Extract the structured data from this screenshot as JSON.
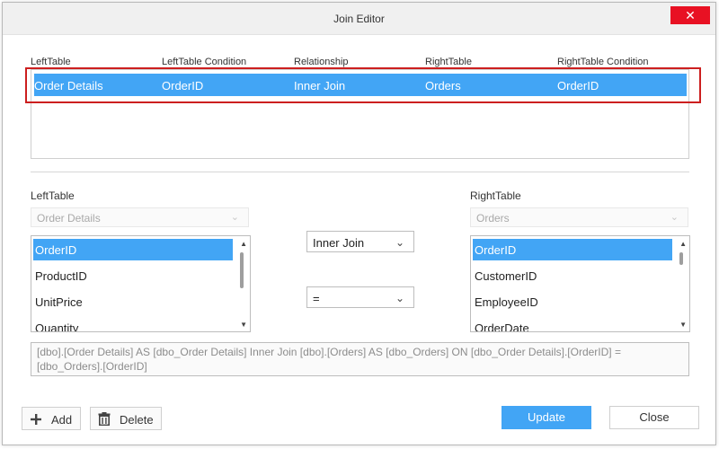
{
  "window": {
    "title": "Join Editor",
    "close_glyph": "✕"
  },
  "grid": {
    "headers": [
      "LeftTable",
      "LeftTable Condition",
      "Relationship",
      "RightTable",
      "RightTable Condition"
    ],
    "rows": [
      {
        "left_table": "Order Details",
        "left_condition": "OrderID",
        "relationship": "Inner Join",
        "right_table": "Orders",
        "right_condition": "OrderID"
      }
    ]
  },
  "left": {
    "label": "LeftTable",
    "table_select": "Order Details",
    "columns": [
      "OrderID",
      "ProductID",
      "UnitPrice",
      "Quantity"
    ],
    "selected_index": 0
  },
  "right": {
    "label": "RightTable",
    "table_select": "Orders",
    "columns": [
      "OrderID",
      "CustomerID",
      "EmployeeID",
      "OrderDate"
    ],
    "selected_index": 0
  },
  "join_type": {
    "value": "Inner Join"
  },
  "operator": {
    "value": "="
  },
  "expression": "[dbo].[Order Details] AS [dbo_Order Details] Inner Join [dbo].[Orders] AS [dbo_Orders] ON [dbo_Order Details].[OrderID] = [dbo_Orders].[OrderID]",
  "footer": {
    "add_label": "Add",
    "delete_label": "Delete",
    "update_label": "Update",
    "close_label": "Close"
  },
  "colors": {
    "accent": "#42a5f5",
    "highlight_border": "#cc1f1f",
    "close_red": "#e81123"
  },
  "icons": {
    "add": "plus-icon",
    "delete": "trash-icon",
    "chevron": "chevron-down-icon"
  }
}
